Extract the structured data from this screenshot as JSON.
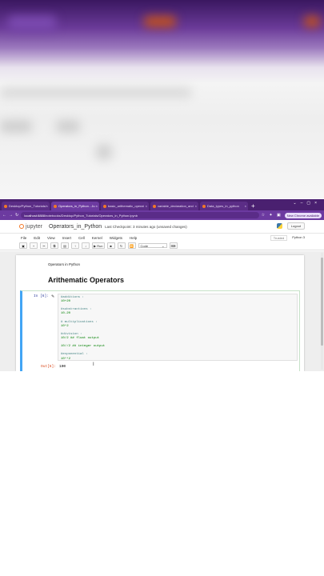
{
  "tabs": [
    {
      "label": "Desktop/Python_Tutorials/"
    },
    {
      "label": "Operators_in_Python - Ju",
      "active": true
    },
    {
      "label": "basic_arithematic_operat"
    },
    {
      "label": "variable_declaration_and"
    },
    {
      "label": "Data_types_in_python"
    }
  ],
  "browser": {
    "url_host": "localhost:8888",
    "url_path": "/notebooks/Desktop/Python_Tutorials/Operators_in_Python.ipynb",
    "chrome_button": "New Chrome available"
  },
  "jupyter": {
    "brand": "jupyter",
    "notebook_name": "Operators_in_Python",
    "checkpoint": "Last Checkpoint: 3 minutes ago  (unsaved changes)",
    "logout": "Logout",
    "trusted": "Trusted",
    "kernel": "Python 3"
  },
  "menu": [
    "File",
    "Edit",
    "View",
    "Insert",
    "Cell",
    "Kernel",
    "Widgets",
    "Help"
  ],
  "toolbar": {
    "run_label": "Run",
    "cell_type": "Code"
  },
  "notebook": {
    "markdown_text": "Operators in Python",
    "heading": "Arithematic Operators",
    "input_prompt": "In [6]:",
    "output_prompt": "Out[6]:",
    "code_lines": [
      {
        "text": "#additions :",
        "kind": "comment"
      },
      {
        "text": "10+20",
        "kind": "num"
      },
      {
        "text": "",
        "kind": "blank"
      },
      {
        "text": "#substractions :",
        "kind": "comment"
      },
      {
        "text": "10-20",
        "kind": "num"
      },
      {
        "text": "",
        "kind": "blank"
      },
      {
        "text": "# multiplications :",
        "kind": "comment"
      },
      {
        "text": "10*2",
        "kind": "num"
      },
      {
        "text": "",
        "kind": "blank"
      },
      {
        "text": "#division :",
        "kind": "comment"
      },
      {
        "text": "10/2 ## float output",
        "kind": "num"
      },
      {
        "text": "",
        "kind": "blank"
      },
      {
        "text": "10//2 ## integer output",
        "kind": "num"
      },
      {
        "text": "",
        "kind": "blank"
      },
      {
        "text": "#exponential :",
        "kind": "comment"
      },
      {
        "text": "10**2",
        "kind": "num"
      }
    ],
    "output_value": "100"
  }
}
